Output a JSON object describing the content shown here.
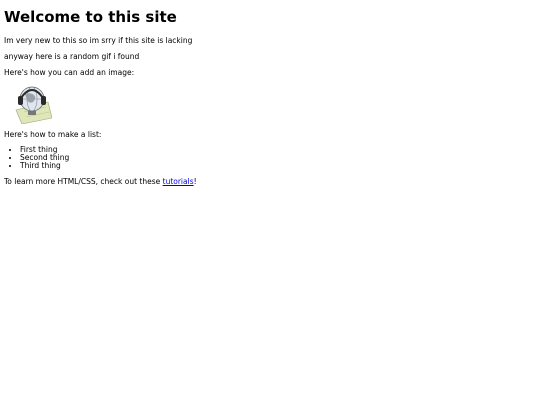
{
  "page": {
    "title": "Welcome to this site",
    "intro": "Im very new to this so im srry if this site is lacking",
    "gif_note": "anyway here is a random gif i found",
    "image_heading": "Here's how you can add an image:",
    "list_heading": "Here's how to make a list:",
    "list_items": [
      "First thing",
      "Second thing",
      "Third thing"
    ],
    "footer_prefix": "To learn more HTML/CSS, check out these ",
    "footer_link": "tutorials",
    "footer_suffix": "!"
  },
  "image": {
    "icon": "globe-icon",
    "colors": {
      "globe": "#dfe6f0",
      "headphones": "#2a2a2a",
      "map": "#dfe6b8"
    }
  },
  "colors": {
    "link": "#0000ee",
    "text": "#000000",
    "background": "#ffffff"
  }
}
